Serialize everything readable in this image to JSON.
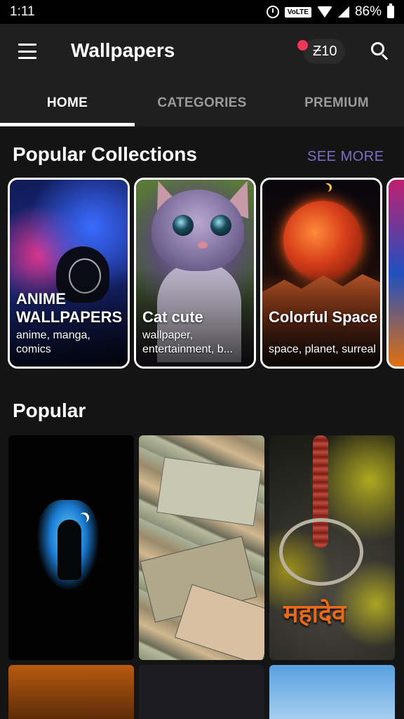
{
  "status_bar": {
    "time": "1:11",
    "network_badge": "VoLTE",
    "battery": "86%",
    "icons": [
      "alarm-icon",
      "wifi-icon",
      "signal-icon",
      "battery-icon"
    ]
  },
  "app_bar": {
    "title": "Wallpapers",
    "coins": "Ƶ10",
    "icons": [
      "menu-icon",
      "search-icon"
    ]
  },
  "tabs": [
    {
      "label": "HOME",
      "active": true
    },
    {
      "label": "CATEGORIES",
      "active": false
    },
    {
      "label": "PREMIUM",
      "active": false
    }
  ],
  "collections": {
    "title": "Popular Collections",
    "see_more": "SEE MORE",
    "items": [
      {
        "title": "ANIME WALLPAPERS",
        "tags": "anime, manga, comics"
      },
      {
        "title": "Cat cute",
        "tags": "wallpaper, entertainment, b..."
      },
      {
        "title": "Colorful Space",
        "tags": "space, planet, surreal"
      }
    ]
  },
  "popular": {
    "title": "Popular",
    "wallpapers": [
      {
        "name": "shiva-neon"
      },
      {
        "name": "currency-notes"
      },
      {
        "name": "rudraksha-mahadev",
        "overlay_text": "महादेव"
      },
      {
        "name": "orange-tile"
      },
      {
        "name": "dark-hand-tile"
      },
      {
        "name": "blue-gods-tile"
      }
    ]
  },
  "colors": {
    "background": "#141414",
    "app_bar": "#1f1f1f",
    "see_more": "#7e6fc6",
    "notification_dot": "#f0375a",
    "active_tab": "#ffffff",
    "inactive_tab": "#9a9a9a"
  }
}
